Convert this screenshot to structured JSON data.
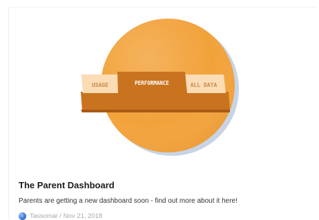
{
  "card": {
    "illustration": {
      "tabs": [
        "USAGE",
        "PERFORMANCE",
        "ALL DATA"
      ],
      "active_tab": "PERFORMANCE",
      "colors": {
        "circle": "#f2a23a",
        "panel": "#c9731f",
        "tab_inactive": "#fbdcb4",
        "tab_active": "#c9731f"
      }
    },
    "title": "The Parent Dashboard",
    "description": "Parents are getting a new dashboard soon - find out more about it here!",
    "author": "Tassomai",
    "separator": "/",
    "date": "Nov 21, 2018",
    "author_icon": "globe-avatar-icon"
  }
}
